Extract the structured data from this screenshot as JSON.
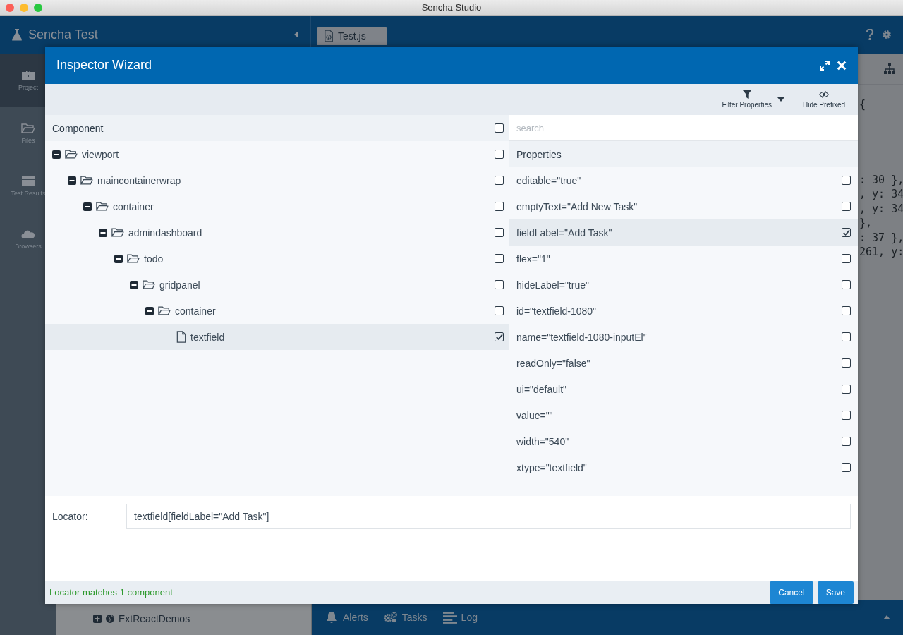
{
  "window": {
    "title": "Sencha Studio"
  },
  "app": {
    "title": "Sencha Test"
  },
  "nav": [
    {
      "label": "Project",
      "kind": "briefcase",
      "selected": true
    },
    {
      "label": "Files",
      "kind": "folder",
      "selected": false
    },
    {
      "label": "Test Results",
      "kind": "server",
      "selected": false
    },
    {
      "label": "Browsers",
      "kind": "cloud",
      "selected": false
    }
  ],
  "project_tree": [
    {
      "label": "ExtReactDemos",
      "expanded": false
    }
  ],
  "editor_tabs": [
    {
      "label": "Test.js"
    }
  ],
  "code_lines": [
    "{",
    ": 30 },",
    ", y: 34",
    ", y: 34",
    " },",
    ": 37 },",
    "261, y:"
  ],
  "bottom_bar": [
    {
      "label": "Alerts",
      "kind": "bell"
    },
    {
      "label": "Tasks",
      "kind": "gears"
    },
    {
      "label": "Log",
      "kind": "lines"
    }
  ],
  "dialog": {
    "title": "Inspector Wizard",
    "toolbar": [
      {
        "label": "Filter Properties",
        "kind": "filter"
      },
      {
        "label": "Hide Prefixed",
        "kind": "eye"
      }
    ],
    "component_header": {
      "label": "Component",
      "checked": false
    },
    "tree": [
      {
        "label": "viewport",
        "kind": "folder",
        "expanded": true,
        "checked": false,
        "selected": false,
        "children": [
          {
            "label": "maincontainerwrap",
            "kind": "folder",
            "expanded": true,
            "checked": false,
            "selected": false,
            "children": [
              {
                "label": "container",
                "kind": "folder",
                "expanded": true,
                "checked": false,
                "selected": false,
                "children": [
                  {
                    "label": "admindashboard",
                    "kind": "folder",
                    "expanded": true,
                    "checked": false,
                    "selected": false,
                    "children": [
                      {
                        "label": "todo",
                        "kind": "folder",
                        "expanded": true,
                        "checked": false,
                        "selected": false,
                        "children": [
                          {
                            "label": "gridpanel",
                            "kind": "folder",
                            "expanded": true,
                            "checked": false,
                            "selected": false,
                            "children": [
                              {
                                "label": "container",
                                "kind": "folder",
                                "expanded": true,
                                "checked": false,
                                "selected": false,
                                "children": [
                                  {
                                    "label": "textfield",
                                    "kind": "file",
                                    "checked": true,
                                    "selected": true
                                  }
                                ]
                              }
                            ]
                          }
                        ]
                      }
                    ]
                  }
                ]
              }
            ]
          }
        ]
      }
    ],
    "search": {
      "placeholder": "search"
    },
    "properties_header": "Properties",
    "properties": [
      {
        "label": "editable=\"true\"",
        "checked": false,
        "selected": false
      },
      {
        "label": "emptyText=\"Add New Task\"",
        "checked": false,
        "selected": false
      },
      {
        "label": "fieldLabel=\"Add Task\"",
        "checked": true,
        "selected": true
      },
      {
        "label": "flex=\"1\"",
        "checked": false,
        "selected": false
      },
      {
        "label": "hideLabel=\"true\"",
        "checked": false,
        "selected": false
      },
      {
        "label": "id=\"textfield-1080\"",
        "checked": false,
        "selected": false
      },
      {
        "label": "name=\"textfield-1080-inputEl\"",
        "checked": false,
        "selected": false
      },
      {
        "label": "readOnly=\"false\"",
        "checked": false,
        "selected": false
      },
      {
        "label": "ui=\"default\"",
        "checked": false,
        "selected": false
      },
      {
        "label": "value=\"\"",
        "checked": false,
        "selected": false
      },
      {
        "label": "width=\"540\"",
        "checked": false,
        "selected": false
      },
      {
        "label": "xtype=\"textfield\"",
        "checked": false,
        "selected": false
      }
    ],
    "locator": {
      "label": "Locator:",
      "value": "textfield[fieldLabel=\"Add Task\"]"
    },
    "status": "Locator matches 1 component",
    "buttons": [
      "Cancel",
      "Save"
    ]
  }
}
